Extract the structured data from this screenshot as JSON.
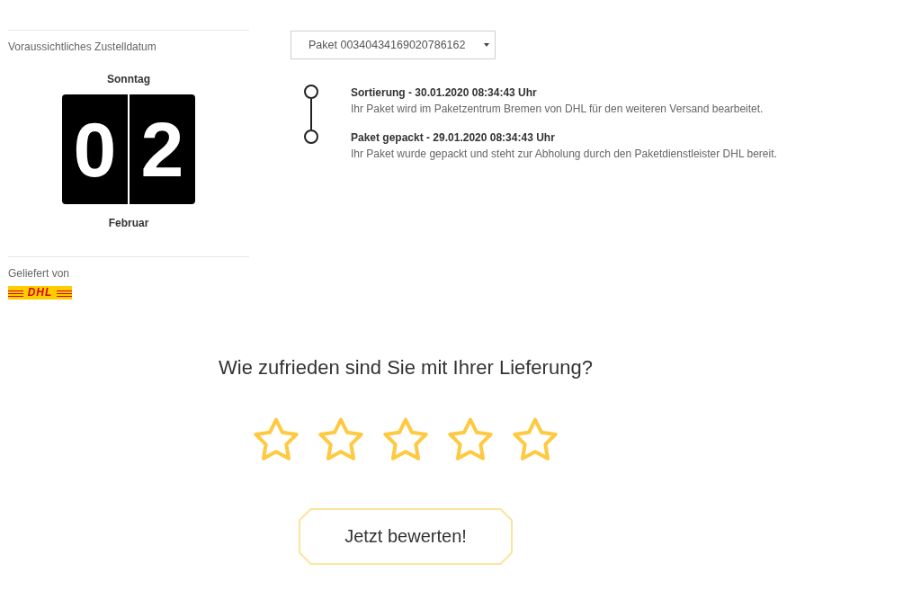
{
  "delivery_date": {
    "label": "Voraussichtliches Zustelldatum",
    "weekday": "Sonntag",
    "day_digits": [
      "0",
      "2"
    ],
    "month": "Februar"
  },
  "carrier": {
    "label": "Geliefert von",
    "logo": "DHL"
  },
  "package_select": {
    "value": "Paket 00340434169020786162"
  },
  "tracking_events": [
    {
      "title": "Sortierung - 30.01.2020 08:34:43 Uhr",
      "description": "Ihr Paket wird im Paketzentrum Bremen von DHL für den weiteren Versand bearbeitet."
    },
    {
      "title": "Paket gepackt - 29.01.2020 08:34:43 Uhr",
      "description": "Ihr Paket wurde gepackt und steht zur Abholung durch den Paketdienstleister DHL bereit."
    }
  ],
  "rating": {
    "question": "Wie zufrieden sind Sie mit Ihrer Lieferung?",
    "stars": 0,
    "submit_button": "Jetzt bewerten!"
  }
}
